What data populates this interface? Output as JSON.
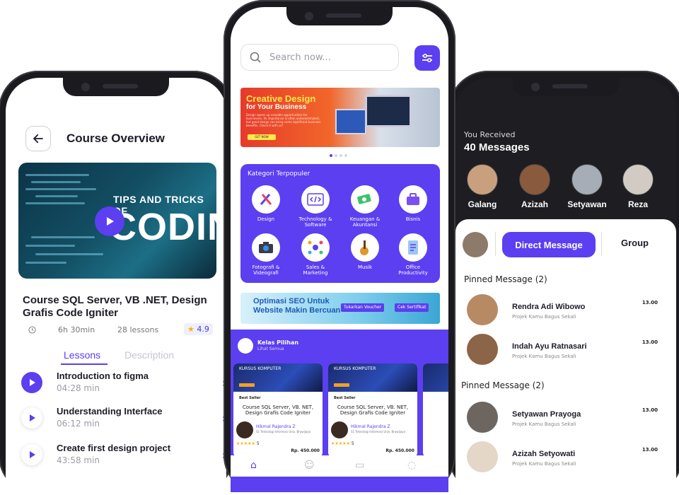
{
  "course": {
    "back_icon": "arrow-left-icon",
    "title": "Course Overview",
    "hero_tips": "TIPS AND TRICKS OF",
    "hero_coding": "CODING",
    "name": "Course SQL Server, VB .NET, Design Grafis Code Igniter",
    "duration": "6h 30min",
    "lessons_count": "28 lessons",
    "rating": "4.9",
    "tabs": [
      "Lessons",
      "Description"
    ],
    "lessons": [
      {
        "title": "Introduction to figma",
        "duration": "04:28 min",
        "active": true
      },
      {
        "title": "Understanding Interface",
        "duration": "06:12 min",
        "active": false
      },
      {
        "title": "Create first design project",
        "duration": "43:58 min",
        "active": false
      }
    ]
  },
  "home": {
    "search_placeholder": "Search now...",
    "banner": {
      "title": "Creative Design",
      "subtitle": "for Your Business",
      "body": "Design opens up valuable opportunities for businesses. Its importance is often underestimated, but good design can bring some significant business benefits. Check it with us!",
      "cta": "GET NOW"
    },
    "categories_title": "Kategori Terpopuler",
    "categories": [
      {
        "label": "Design",
        "icon": "design-tools-icon"
      },
      {
        "label": "Technology & Software",
        "icon": "code-icon"
      },
      {
        "label": "Keuangan & Akuntansi",
        "icon": "money-icon"
      },
      {
        "label": "Bisnis",
        "icon": "briefcase-icon"
      },
      {
        "label": "Fotografi & Videografi",
        "icon": "camera-icon"
      },
      {
        "label": "Sales & Marketing",
        "icon": "network-icon"
      },
      {
        "label": "Musik",
        "icon": "guitar-icon"
      },
      {
        "label": "Office Productivity",
        "icon": "document-icon"
      }
    ],
    "seo_banner": {
      "title": "Optimasi SEO Untuk Website Makin Bercuan",
      "voucher": "Tukarkan Voucher",
      "certificate": "Cek Sertifikat"
    },
    "kelas_title": "Kelas Pilihan",
    "kelas_sub": "Lihat Semua",
    "cards": [
      {
        "badge": "KURSUS KOMPUTER",
        "tag": "Best Seller",
        "title": "Course SQL Server, VB. NET, Design Grafis Code Igniter",
        "author": "Hikmal Rajendra Z",
        "org": "S1 Teknologi Informasi Univ. Brawijaya",
        "rating": "5",
        "price": "Rp. 450.000"
      },
      {
        "badge": "KURSUS KOMPUTER",
        "tag": "Best Seller",
        "title": "Course SQL Server, VB. NET, Design Grafis Code Igniter",
        "author": "Hikmal Rajendra Z",
        "org": "S1 Teknologi Informasi Univ. Brawijaya",
        "rating": "5",
        "price": "Rp. 450.000"
      }
    ]
  },
  "messages": {
    "received_label": "You Received",
    "count_label": "40 Messages",
    "people": [
      {
        "name": "Galang",
        "color": "#c9a07e"
      },
      {
        "name": "Azizah",
        "color": "#8a5a3c"
      },
      {
        "name": "Setyawan",
        "color": "#a7adb6"
      },
      {
        "name": "Reza",
        "color": "#d2cbc4"
      }
    ],
    "tabs": [
      "Direct Message",
      "Group"
    ],
    "pinned_1": "Pinned Message (2)",
    "pinned_2": "Pinned Message (2)",
    "items": [
      {
        "name": "Rendra Adi Wibowo",
        "preview": "Projek Kamu Bagus Sekali",
        "time": "13.00",
        "color": "#b78a63"
      },
      {
        "name": "Indah Ayu Ratnasari",
        "preview": "Projek Kamu Bagus Sekali",
        "time": "13.00",
        "color": "#8c6448"
      },
      {
        "name": "Setyawan Prayoga",
        "preview": "Projek Kamu Bagus Sekali",
        "time": "13.00",
        "color": "#6d6660"
      },
      {
        "name": "Azizah Setyowati",
        "preview": "Projek Kamu Bagus Sekali",
        "time": "13.00",
        "color": "#e4d7c8"
      }
    ]
  },
  "colors": {
    "accent": "#5b3ff0",
    "dark": "#1d1d22"
  }
}
